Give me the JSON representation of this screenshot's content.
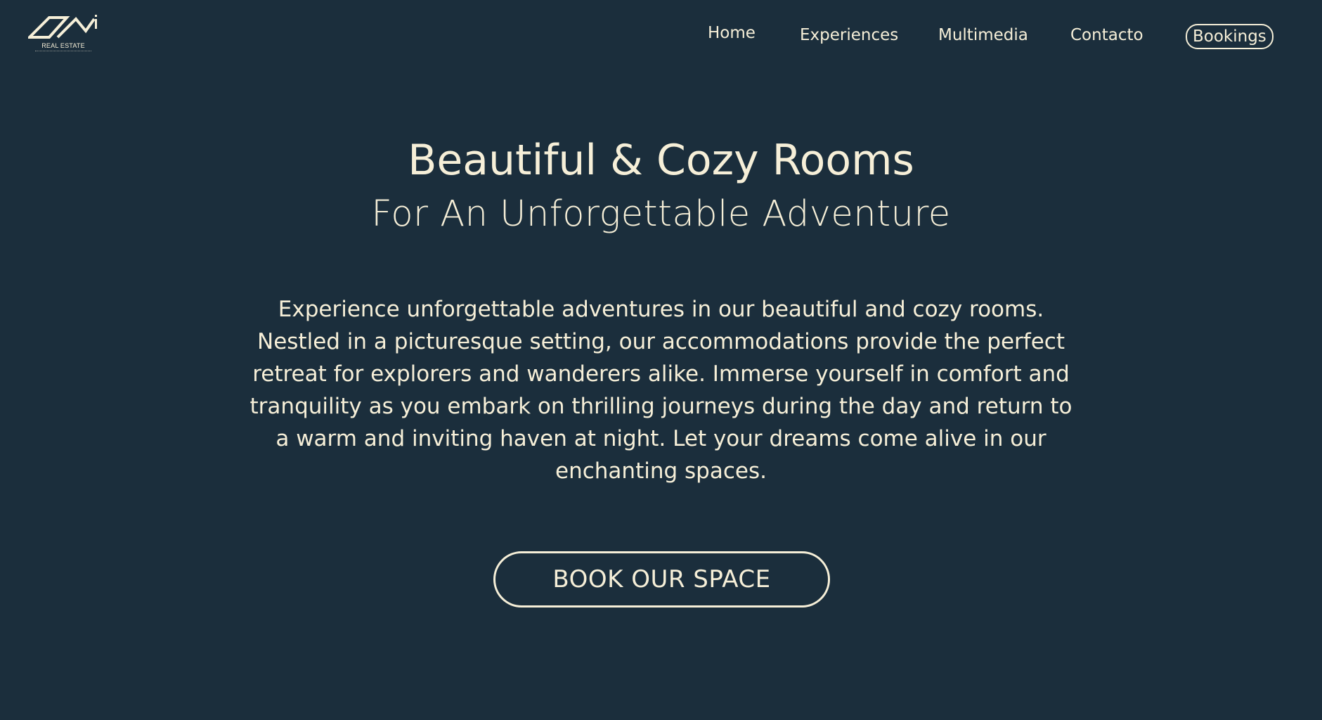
{
  "header": {
    "logo": {
      "icon": "house-roof-logo-icon",
      "text": "REAL ESTATE"
    },
    "nav": {
      "home": "Home",
      "experiences": "Experiences",
      "multimedia": "Multimedia",
      "contacto": "Contacto",
      "bookings": "Bookings"
    }
  },
  "hero": {
    "title": "Beautiful & Cozy Rooms",
    "subtitle": "For An Unforgettable Adventure",
    "body": "Experience unforgettable adventures in our beautiful and cozy rooms. Nestled in a picturesque setting, our accommodations provide the perfect retreat for explorers and wanderers alike. Immerse yourself in comfort and tranquility as you embark on thrilling journeys during the day and return to a warm and inviting haven at night. Let your dreams come alive in our enchanting spaces.",
    "cta": "BOOK OUR SPACE"
  },
  "colors": {
    "background": "#1b2e3c",
    "text": "#f6efd8"
  }
}
